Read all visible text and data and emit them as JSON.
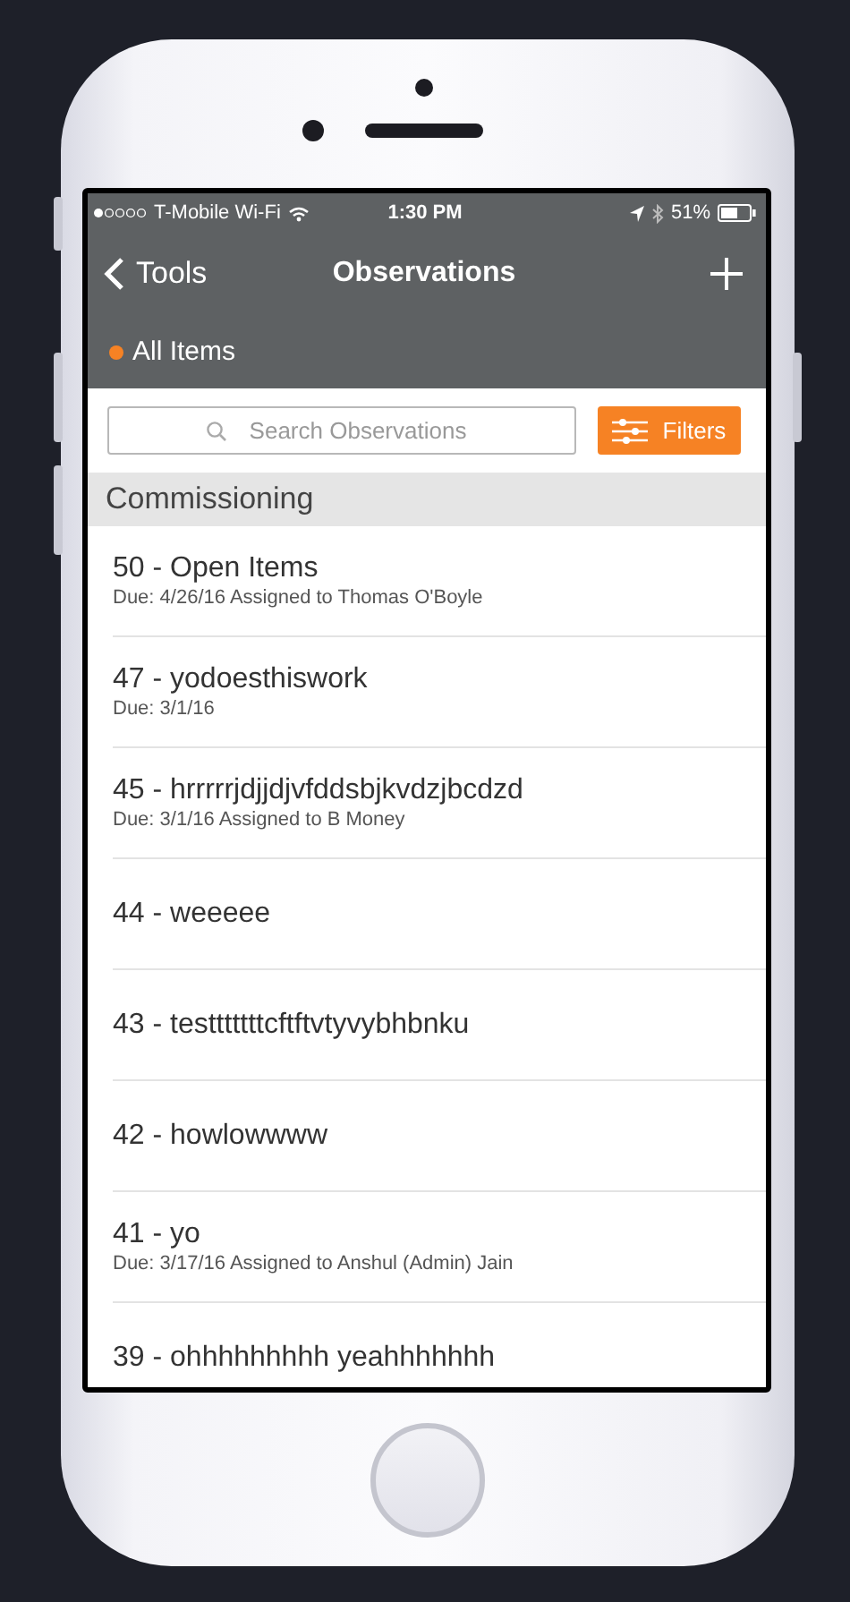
{
  "status_bar": {
    "carrier": "T-Mobile Wi-Fi",
    "time": "1:30 PM",
    "battery": "51%"
  },
  "nav": {
    "back": "Tools",
    "title": "Observations"
  },
  "scope": {
    "label": "All Items"
  },
  "search": {
    "placeholder": "Search Observations"
  },
  "filters_button": "Filters",
  "section": "Commissioning",
  "rows": [
    {
      "title": "50 - Open Items",
      "subtitle": "Due: 4/26/16 Assigned to Thomas O'Boyle"
    },
    {
      "title": "47 - yodoesthiswork",
      "subtitle": "Due: 3/1/16"
    },
    {
      "title": "45 - hrrrrrjdjjdjvfddsbjkvdzjbcdzd",
      "subtitle": "Due: 3/1/16 Assigned to B Money"
    },
    {
      "title": "44 - weeeee"
    },
    {
      "title": "43 - testttttttcftftvtyvybhbnku"
    },
    {
      "title": "42 - howlowwww"
    },
    {
      "title": "41 - yo",
      "subtitle": "Due: 3/17/16 Assigned to Anshul (Admin) Jain"
    },
    {
      "title": "39 - ohhhhhhhhh yeahhhhhhh"
    }
  ]
}
